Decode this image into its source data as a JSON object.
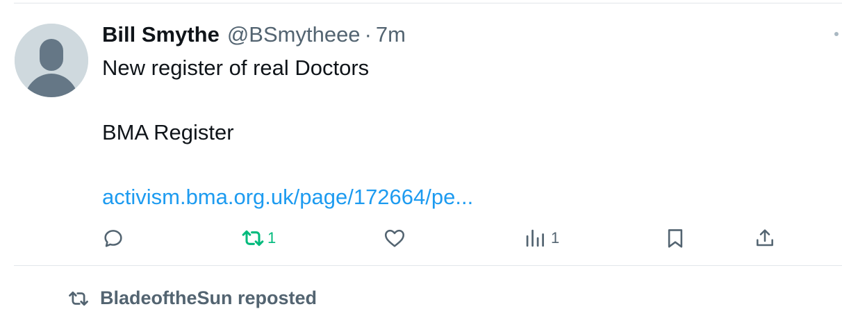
{
  "tweet": {
    "display_name": "Bill Smythe",
    "handle": "@BSmytheee",
    "separator": "·",
    "time": "7m",
    "text_line1": "New register of real Doctors",
    "text_line2": "BMA Register",
    "link": "activism.bma.org.uk/page/172664/pe...",
    "actions": {
      "reply_icon": "reply-icon",
      "retweet_icon": "retweet-icon",
      "retweet_count": "1",
      "like_icon": "heart-icon",
      "views_icon": "views-chart-icon",
      "views_count": "1",
      "bookmark_icon": "bookmark-icon",
      "share_icon": "share-icon"
    },
    "colors": {
      "link": "#1d9bf0",
      "retweet_active": "#00ba7c",
      "secondary_text": "#536471",
      "avatar_bg": "#cfd9de"
    }
  },
  "next_item": {
    "repost_icon": "retweet-icon",
    "repost_label": "BladeoftheSun reposted"
  }
}
